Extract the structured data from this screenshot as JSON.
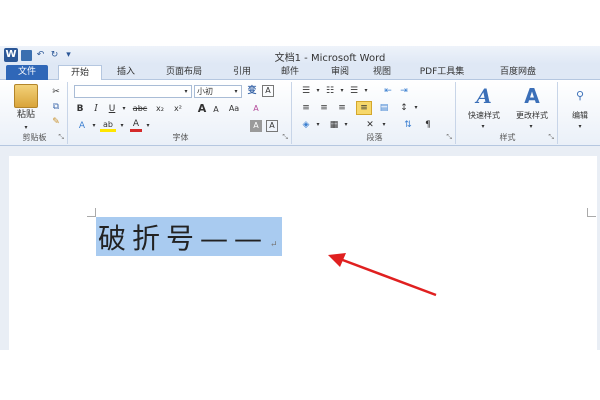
{
  "window": {
    "title": "文档1 - Microsoft Word",
    "logo_letter": "W"
  },
  "quick_access": {
    "icons": [
      "save-icon",
      "undo-icon",
      "redo-icon",
      "customize-icon"
    ],
    "glyphs": [
      "▪",
      "↶",
      "↻",
      "▾"
    ]
  },
  "tabs": [
    {
      "label": "文件",
      "kind": "file"
    },
    {
      "label": "开始",
      "kind": "active"
    },
    {
      "label": "插入",
      "kind": "normal"
    },
    {
      "label": "页面布局",
      "kind": "normal"
    },
    {
      "label": "引用",
      "kind": "normal"
    },
    {
      "label": "邮件",
      "kind": "normal"
    },
    {
      "label": "审阅",
      "kind": "normal"
    },
    {
      "label": "视图",
      "kind": "normal"
    },
    {
      "label": "PDF工具集",
      "kind": "normal"
    },
    {
      "label": "百度网盘",
      "kind": "normal"
    }
  ],
  "ribbon": {
    "clipboard": {
      "label": "剪贴板",
      "paste_label": "粘贴",
      "cut_glyph": "✂",
      "copy_glyph": "⧉",
      "painter_glyph": "✎"
    },
    "font": {
      "label": "字体",
      "font_name": "",
      "font_size": "小初",
      "bold": "B",
      "italic": "I",
      "underline": "U",
      "strike": "abc",
      "subscript": "x₂",
      "superscript": "x²",
      "grow": "A",
      "shrink": "A",
      "change_case": "Aa",
      "clear_format": "A",
      "wen": "变",
      "border_a": "A",
      "shading_a": "A",
      "highlight": "ab",
      "font_color": "A",
      "effect": "A",
      "char_border": "A"
    },
    "paragraph": {
      "label": "段落"
    },
    "styles": {
      "label": "样式",
      "quick_style_label": "快速样式",
      "change_style_label": "更改样式"
    },
    "editing": {
      "label": "编辑"
    }
  },
  "document": {
    "text": "破折号——",
    "para_mark": "↵"
  }
}
